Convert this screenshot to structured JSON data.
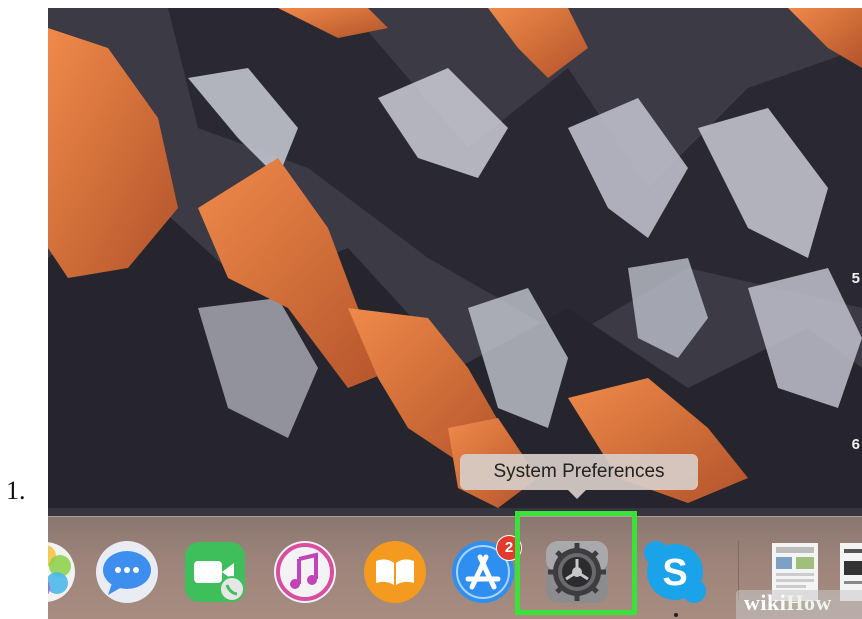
{
  "step": {
    "number": "1."
  },
  "tooltip": {
    "text": "System Preferences"
  },
  "edge_labels": [
    "5",
    "6"
  ],
  "dock": {
    "items": [
      {
        "name": "Photos",
        "icon": "photos-icon"
      },
      {
        "name": "Messages",
        "icon": "messages-icon"
      },
      {
        "name": "FaceTime",
        "icon": "facetime-icon"
      },
      {
        "name": "iTunes",
        "icon": "itunes-icon"
      },
      {
        "name": "iBooks",
        "icon": "ibooks-icon"
      },
      {
        "name": "App Store",
        "icon": "app-store-icon",
        "badge": "2"
      },
      {
        "name": "System Preferences",
        "icon": "system-preferences-icon",
        "highlighted": true
      },
      {
        "name": "Skype",
        "icon": "skype-icon"
      },
      {
        "name": "Preview document",
        "icon": "document-thumbnail-icon"
      },
      {
        "name": "Document",
        "icon": "document-thumbnail-icon"
      }
    ]
  },
  "watermark": {
    "wiki": "wiki",
    "how": "How"
  },
  "colors": {
    "highlight": "#3be03a",
    "badge": "#e23b2e"
  }
}
